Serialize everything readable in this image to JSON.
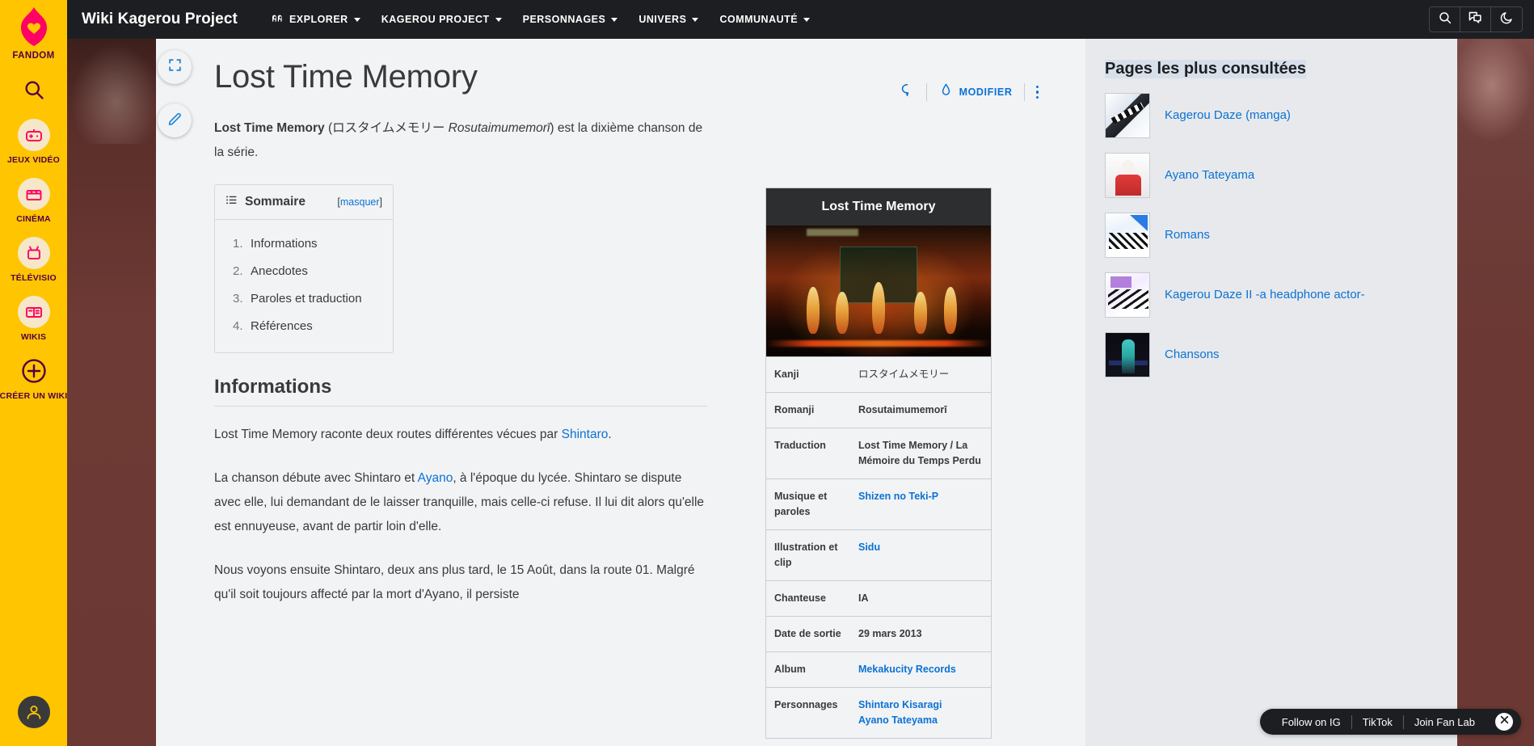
{
  "fandom_rail": {
    "brand": "FANDOM",
    "items": [
      {
        "label": "",
        "icon": "search-icon",
        "name": "rail-search"
      },
      {
        "label": "JEUX VIDÉO",
        "icon": "gamepad-icon",
        "name": "rail-games"
      },
      {
        "label": "CINÉMA",
        "icon": "clapperboard-icon",
        "name": "rail-movies"
      },
      {
        "label": "TÉLÉVISIO",
        "icon": "tv-icon",
        "name": "rail-tv"
      },
      {
        "label": "WIKIS",
        "icon": "book-icon",
        "name": "rail-wikis"
      },
      {
        "label": "CRÉER UN WIKI",
        "icon": "plus-icon",
        "name": "rail-create-wiki"
      }
    ]
  },
  "nav": {
    "wiki_title": "Wiki Kagerou Project",
    "items": [
      {
        "label": "EXPLORER",
        "has_caret": true,
        "icon": "explore-icon"
      },
      {
        "label": "KAGEROU PROJECT",
        "has_caret": true
      },
      {
        "label": "PERSONNAGES",
        "has_caret": true
      },
      {
        "label": "UNIVERS",
        "has_caret": true
      },
      {
        "label": "COMMUNAUTÉ",
        "has_caret": true
      }
    ],
    "right_icons": [
      {
        "name": "search-icon",
        "label": "Rechercher"
      },
      {
        "name": "discussion-icon",
        "label": "Discussions"
      },
      {
        "name": "dark-mode-icon",
        "label": "Mode sombre"
      }
    ]
  },
  "page": {
    "title": "Lost Time Memory",
    "actions": {
      "comment_icon": "comment-icon",
      "edit_icon": "pen-icon",
      "edit_label": "MODIFIER",
      "more_icon": "more-options-icon"
    },
    "float_buttons": [
      {
        "name": "fullscreen-button",
        "icon": "expand-icon"
      },
      {
        "name": "quick-edit-button",
        "icon": "pencil-icon"
      }
    ]
  },
  "intro": {
    "bold_title": "Lost Time Memory",
    "open_paren": " (",
    "kana": "ロスタイムメモリー ",
    "romaji": "Rosutaimumemorī",
    "close_paren": ") est la dixième chanson de la série."
  },
  "toc": {
    "icon": "list-icon",
    "title": "Sommaire",
    "toggle_open": "[",
    "toggle_label": "masquer",
    "toggle_close": "]",
    "items": [
      {
        "num": "1.",
        "text": "Informations"
      },
      {
        "num": "2.",
        "text": "Anecdotes"
      },
      {
        "num": "3.",
        "text": "Paroles et traduction"
      },
      {
        "num": "4.",
        "text": "Références"
      }
    ]
  },
  "sections": {
    "informations_heading": "Informations",
    "p1_a": "Lost Time Memory raconte deux routes différentes vécues par ",
    "p1_link": "Shintaro",
    "p1_b": ".",
    "p2_a": "La chanson débute avec Shintaro et ",
    "p2_link": "Ayano",
    "p2_b": ", à l'époque du lycée. Shintaro se dispute avec elle, lui demandant de le laisser tranquille, mais celle-ci refuse. Il lui dit alors qu'elle est ennuyeuse, avant de partir loin d'elle.",
    "p3": "Nous voyons ensuite Shintaro, deux ans plus tard, le 15 Août, dans la route 01. Malgré qu'il soit toujours affecté par la mort d'Ayano, il persiste"
  },
  "infobox": {
    "title": "Lost Time Memory",
    "image_alt": "Lost Time Memory music video still",
    "rows": [
      {
        "key": "Kanji",
        "value": "ロスタイムメモリー",
        "type": "jp"
      },
      {
        "key": "Romanji",
        "value": "Rosutaimumemorī",
        "type": "text"
      },
      {
        "key": "Traduction",
        "value": "Lost Time Memory / La Mémoire du Temps Perdu",
        "type": "text"
      },
      {
        "key": "Musique et paroles",
        "value": "Shizen no Teki-P",
        "type": "link"
      },
      {
        "key": "Illustration et clip",
        "value": "Sidu",
        "type": "link"
      },
      {
        "key": "Chanteuse",
        "value": "IA",
        "type": "text"
      },
      {
        "key": "Date de sortie",
        "value": "29 mars 2013",
        "type": "text"
      },
      {
        "key": "Album",
        "value": "Mekakucity Records",
        "type": "link"
      },
      {
        "key": "Personnages",
        "value": "Shintaro Kisaragi",
        "value2": "Ayano Tateyama",
        "type": "link-multi"
      }
    ]
  },
  "right_rail": {
    "title": "Pages les plus consultées",
    "items": [
      {
        "label": "Kagerou Daze (manga)",
        "thumb": "t1"
      },
      {
        "label": "Ayano Tateyama",
        "thumb": "t2"
      },
      {
        "label": "Romans",
        "thumb": "t3"
      },
      {
        "label": "Kagerou Daze II -a headphone actor-",
        "thumb": "t4"
      },
      {
        "label": "Chansons",
        "thumb": "t5"
      }
    ]
  },
  "social_bar": {
    "links": [
      "Follow on IG",
      "TikTok",
      "Join Fan Lab"
    ],
    "close_icon": "close-icon"
  },
  "colors": {
    "fandom_yellow": "#ffc500",
    "fandom_purple": "#520044",
    "fandom_pink": "#ff0064",
    "nav_dark": "#1d1e21",
    "link_blue": "#0b72d4",
    "article_bg": "#f2f3f5",
    "rail_bg": "#e7e9ec"
  }
}
